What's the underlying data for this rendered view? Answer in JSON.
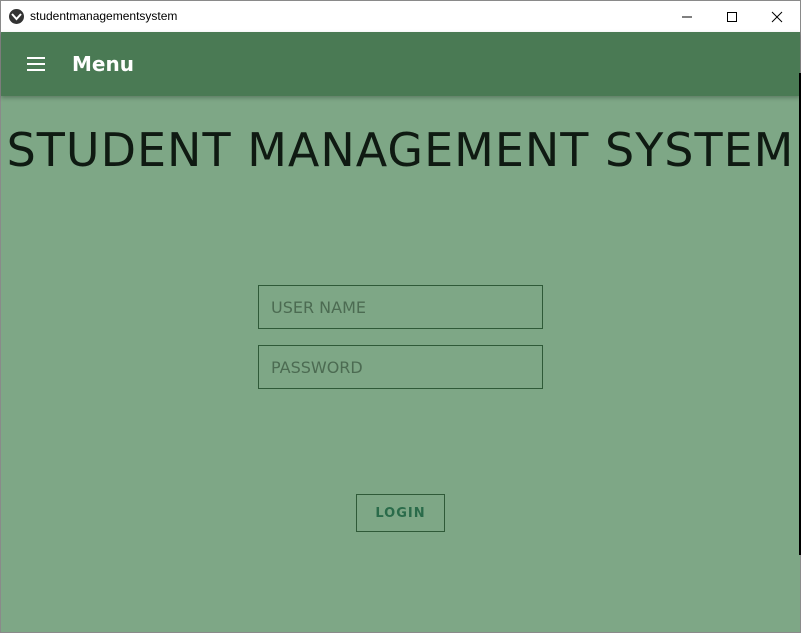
{
  "window": {
    "title": "studentmanagementsystem",
    "controls": {
      "minimize_icon": "minimize-icon",
      "maximize_icon": "maximize-icon",
      "close_icon": "close-icon"
    }
  },
  "appbar": {
    "menu_icon": "hamburger-menu-icon",
    "title": "Menu",
    "color": "#4a7a54"
  },
  "main": {
    "heading": "STUDENT MANAGEMENT SYSTEM",
    "background_color": "#7ea786",
    "username": {
      "value": "",
      "placeholder": "USER NAME"
    },
    "password": {
      "value": "",
      "placeholder": "PASSWORD"
    },
    "login_label": "LOGIN"
  }
}
